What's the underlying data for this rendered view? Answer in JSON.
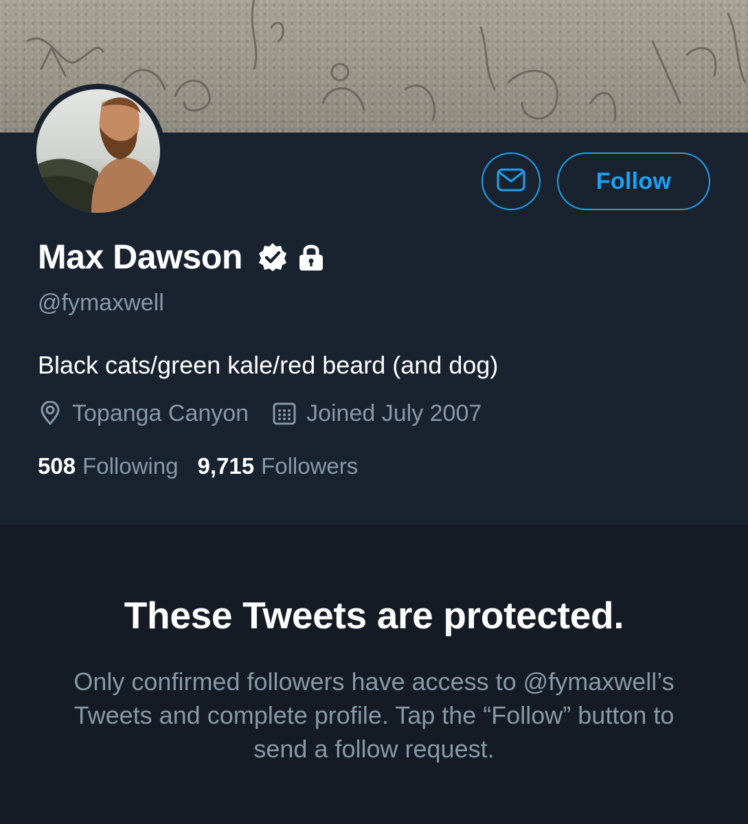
{
  "profile": {
    "name": "Max Dawson",
    "handle": "@fymaxwell",
    "bio": "Black cats/green kale/red beard (and dog)",
    "location": "Topanga Canyon",
    "joined": "Joined July 2007",
    "following_count": "508",
    "following_label": "Following",
    "followers_count": "9,715",
    "followers_label": "Followers",
    "verified": true,
    "protected": true
  },
  "actions": {
    "follow_label": "Follow",
    "message_icon": "envelope-icon"
  },
  "protected_notice": {
    "title": "These Tweets are protected.",
    "body": "Only confirmed followers have access to @fymaxwell’s Tweets and complete profile. Tap the “Follow” button to send a follow request."
  },
  "colors": {
    "accent": "#1da1f2",
    "background": "#151c26",
    "card": "#192330",
    "secondary_text": "#8899a6",
    "primary_text": "#ffffff"
  }
}
